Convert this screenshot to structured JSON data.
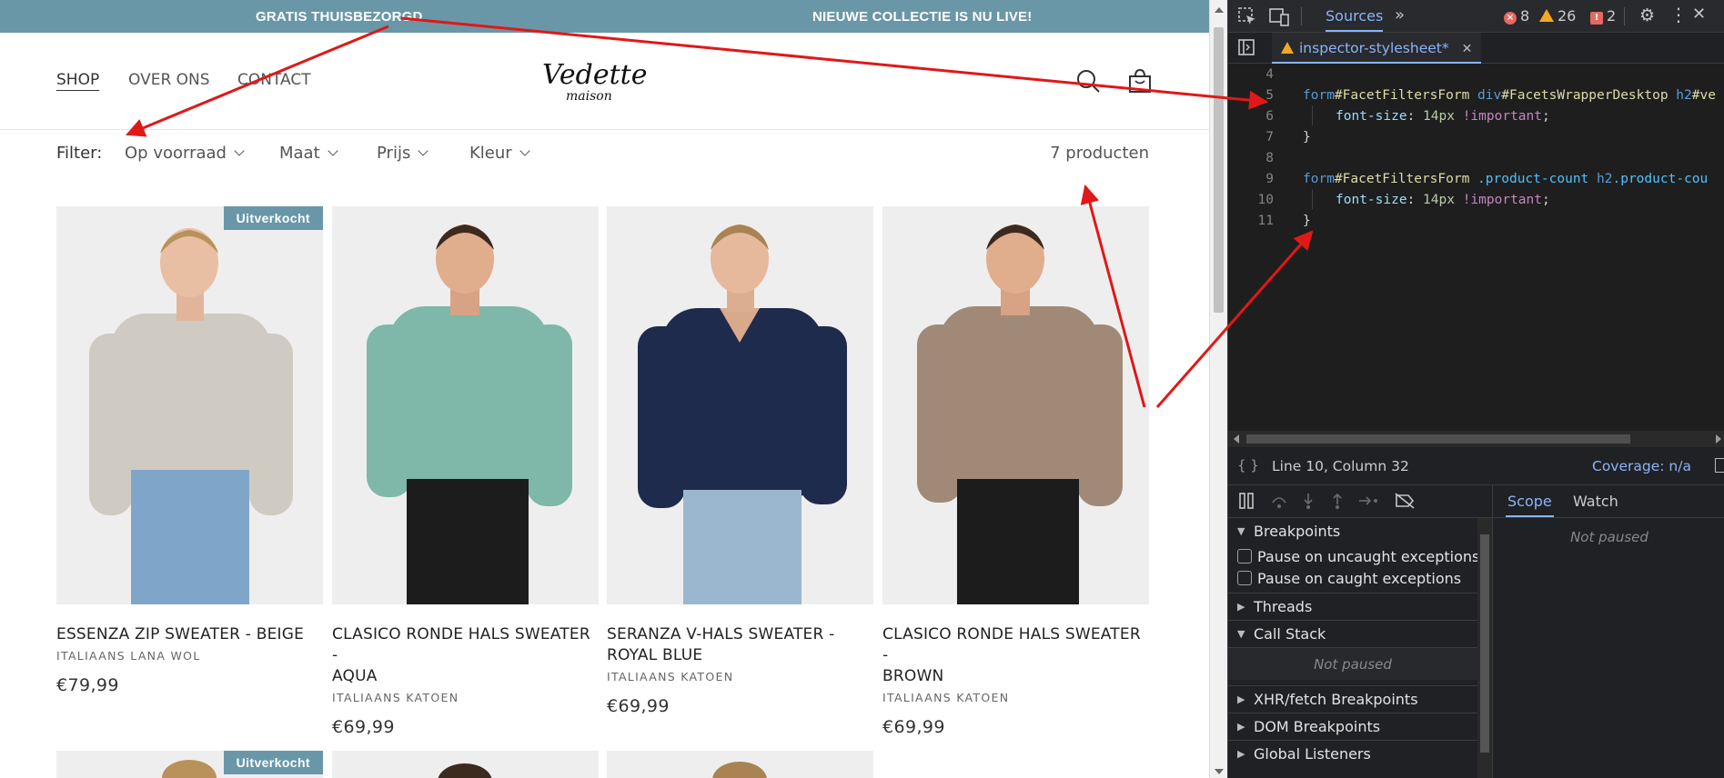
{
  "announcement": {
    "left": "GRATIS THUISBEZORGD",
    "right": "NIEUWE COLLECTIE IS NU LIVE!"
  },
  "nav": {
    "shop": "SHOP",
    "about": "OVER ONS",
    "contact": "CONTACT"
  },
  "logo": {
    "main": "Vedette",
    "sub": "maison"
  },
  "filter": {
    "label": "Filter:",
    "stock": "Op voorraad",
    "size": "Maat",
    "price": "Prijs",
    "color": "Kleur",
    "count": "7 producten"
  },
  "products": [
    {
      "title_1": "ESSENZA ZIP SWEATER - BEIGE",
      "title_2": "",
      "material": "ITALIAANS LANA WOL",
      "price": "€79,99",
      "badge": "Uitverkocht",
      "color": "#cfcac2"
    },
    {
      "title_1": "CLASICO RONDE HALS SWEATER -",
      "title_2": "AQUA",
      "material": "ITALIAANS KATOEN",
      "price": "€69,99",
      "badge": "",
      "color": "#7fb7a8"
    },
    {
      "title_1": "SERANZA V-HALS SWEATER -",
      "title_2": "ROYAL BLUE",
      "material": "ITALIAANS KATOEN",
      "price": "€69,99",
      "badge": "",
      "color": "#1f2b4d"
    },
    {
      "title_1": "CLASICO RONDE HALS SWEATER -",
      "title_2": "BROWN",
      "material": "ITALIAANS KATOEN",
      "price": "€69,99",
      "badge": "",
      "color": "#a08a77"
    }
  ],
  "row2_badge": "Uitverkocht",
  "devtools": {
    "sources_tab": "Sources",
    "errors": "8",
    "warnings": "26",
    "issues": "2",
    "file_tab": "inspector-stylesheet*",
    "lines": [
      "4",
      "5",
      "6",
      "7",
      "8",
      "9",
      "10",
      "11"
    ],
    "code": {
      "l5_form": "form",
      "l5_id1": "#FacetFiltersForm",
      "l5_div": " div",
      "l5_id2": "#FacetsWrapperDesktop",
      "l5_h2": " h2",
      "l5_tail": "#ve",
      "prop": "font-size",
      "num": "14px",
      "imp": "!important",
      "l9_form": "form",
      "l9_id": "#FacetFiltersForm",
      "l9_cls1": " .product-count",
      "l9_h2": " h2",
      "l9_cls2": ".product-cou",
      "close": "}",
      "colon": ": ",
      "semi": ";",
      "open": " {"
    },
    "status_pos": "Line 10, Column 32",
    "coverage": "Coverage: n/a",
    "scope_tab": "Scope",
    "watch_tab": "Watch",
    "not_paused": "Not paused",
    "breakpoints": "Breakpoints",
    "pause_uncaught": "Pause on uncaught exceptions",
    "pause_caught": "Pause on caught exceptions",
    "threads": "Threads",
    "call_stack": "Call Stack",
    "xhr": "XHR/fetch Breakpoints",
    "dom": "DOM Breakpoints",
    "global": "Global Listeners"
  }
}
